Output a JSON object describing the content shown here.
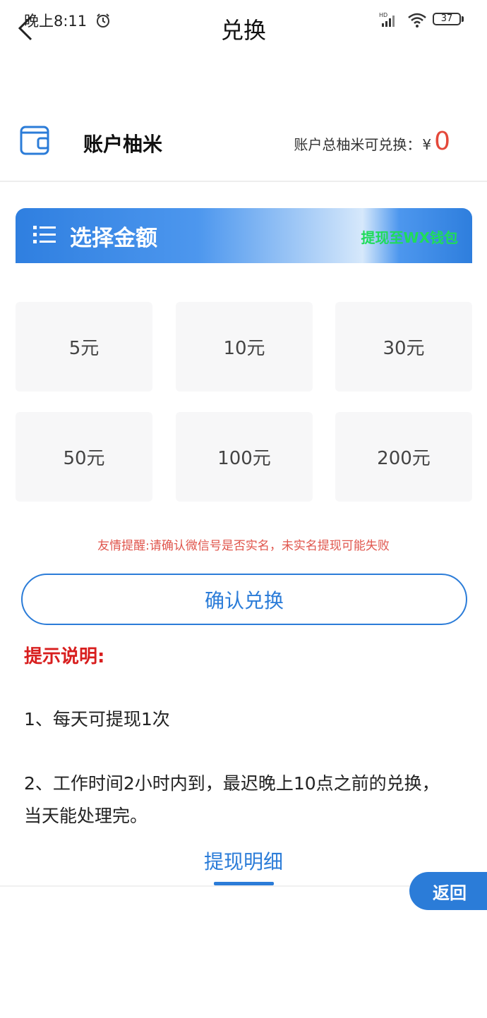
{
  "status_bar": {
    "time": "晚上8:11",
    "network": "HD",
    "battery": "37"
  },
  "header": {
    "title": "兑换"
  },
  "account": {
    "label": "账户柚米",
    "redeemable_label": "账户总柚米可兑换：",
    "currency": "¥",
    "amount": "0"
  },
  "banner": {
    "title": "选择金额",
    "link": "提现至WX钱包"
  },
  "amounts": [
    "5元",
    "10元",
    "30元",
    "50元",
    "100元",
    "200元"
  ],
  "warning": "友情提醒:请确认微信号是否实名，未实名提现可能失败",
  "confirm_button": "确认兑换",
  "tips": {
    "title": "提示说明:",
    "items": [
      "1、每天可提现1次",
      "2、工作时间2小时内到，最迟晚上10点之前的兑换，当天能处理完。"
    ]
  },
  "tab": {
    "label": "提现明细"
  },
  "return_button": "返回",
  "colors": {
    "accent": "#2b7cd8",
    "warning": "#e0564d",
    "highlight_green": "#1fdc5a",
    "tips_red": "#d81e1e"
  }
}
